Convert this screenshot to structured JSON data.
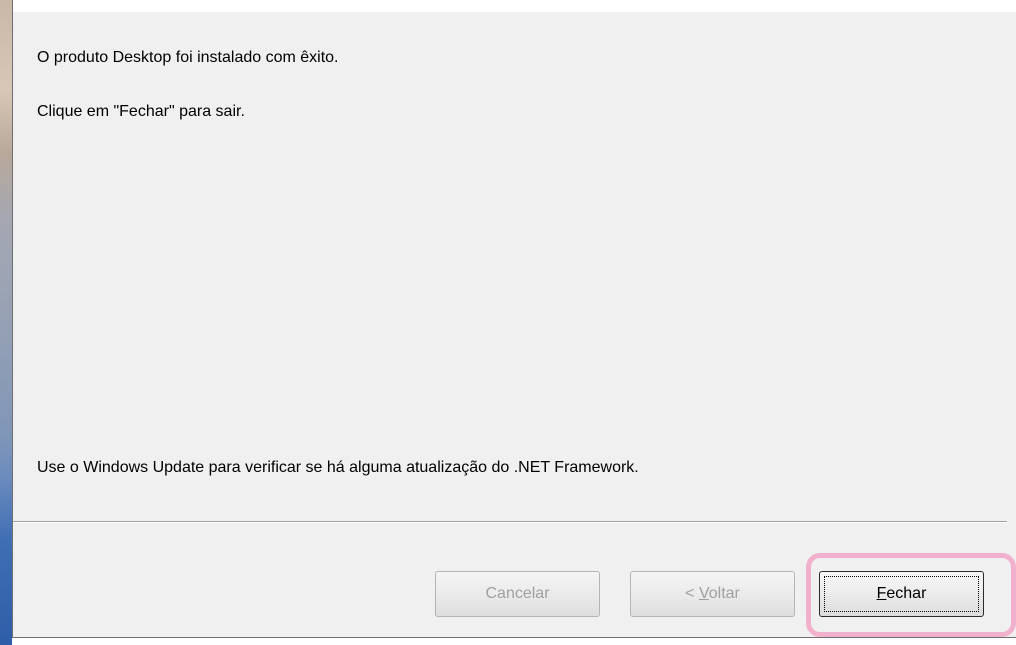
{
  "dialog": {
    "messages": [
      "O produto  Desktop foi instalado com êxito.",
      "Clique em \"Fechar\" para sair.",
      "Use o Windows Update para verificar se há alguma atualização do .NET Framework."
    ],
    "buttons": {
      "cancel": {
        "label": "Cancelar",
        "enabled": false
      },
      "back": {
        "prefix": "< ",
        "mnemonic": "V",
        "rest": "oltar",
        "enabled": false
      },
      "close": {
        "mnemonic": "F",
        "rest": "echar",
        "enabled": true
      }
    },
    "highlight_color": "#f1b0cc"
  }
}
